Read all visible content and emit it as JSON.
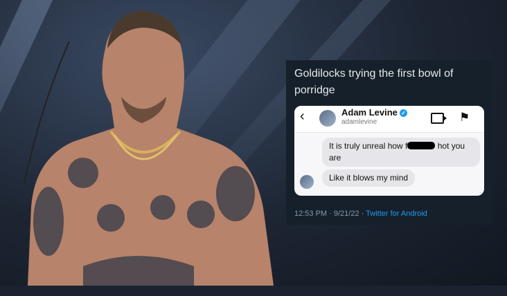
{
  "tweet": {
    "text": "Goldilocks trying the first bowl of porridge",
    "timestamp": "12:53 PM · 9/21/22 · ",
    "source": "Twitter for Android"
  },
  "dm": {
    "name": "Adam Levine",
    "handle": "adamlevine",
    "verified_icon": "✓",
    "message_1_before": "It is truly unreal how f",
    "message_1_after": " hot you are",
    "message_2": "Like it blows my mind"
  },
  "colors": {
    "tweet_bg": "#15202b",
    "link": "#1d9bf0",
    "verified": "#1d9bf0"
  }
}
